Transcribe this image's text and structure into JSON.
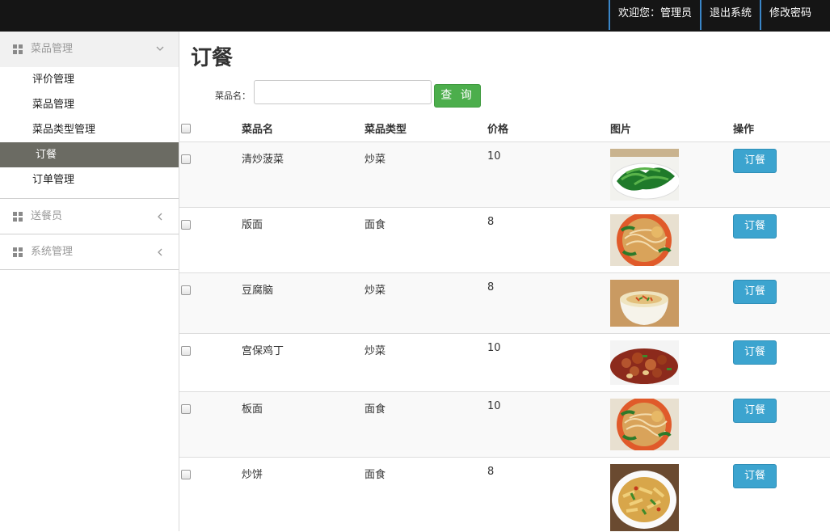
{
  "topnav": {
    "welcome": "欢迎您：管理员",
    "logout": "退出系统",
    "change_password": "修改密码"
  },
  "sidebar": {
    "groups": [
      {
        "label": "菜品管理",
        "expanded": true,
        "items": [
          {
            "label": "评价管理"
          },
          {
            "label": "菜品管理"
          },
          {
            "label": "菜品类型管理"
          },
          {
            "label": "订餐",
            "active": true
          },
          {
            "label": "订单管理"
          }
        ]
      },
      {
        "label": "送餐员",
        "expanded": false
      },
      {
        "label": "系统管理",
        "expanded": false
      }
    ]
  },
  "main": {
    "title": "订餐",
    "search": {
      "label": "菜品名：",
      "value": "",
      "button": "查 询"
    },
    "columns": {
      "name": "菜品名",
      "type": "菜品类型",
      "price": "价格",
      "image": "图片",
      "action": "操作"
    },
    "rows": [
      {
        "name": "清炒菠菜",
        "type": "炒菜",
        "price": "10",
        "image": "spinach-dish",
        "action": "订餐"
      },
      {
        "name": "版面",
        "type": "面食",
        "price": "8",
        "image": "noodle-dish",
        "action": "订餐"
      },
      {
        "name": "豆腐脑",
        "type": "炒菜",
        "price": "8",
        "image": "tofu-pudding-dish",
        "action": "订餐"
      },
      {
        "name": "宫保鸡丁",
        "type": "炒菜",
        "price": "10",
        "image": "kungpao-chicken-dish",
        "action": "订餐"
      },
      {
        "name": "板面",
        "type": "面食",
        "price": "10",
        "image": "noodle-dish",
        "action": "订餐"
      },
      {
        "name": "炒饼",
        "type": "面食",
        "price": "8",
        "image": "fried-pancake-dish",
        "action": "订餐"
      }
    ]
  },
  "colors": {
    "topbar": "#151515",
    "accent_blue": "#3ca4cf",
    "search_green": "#4cae4c",
    "active_sidebar": "#6b6b63"
  }
}
